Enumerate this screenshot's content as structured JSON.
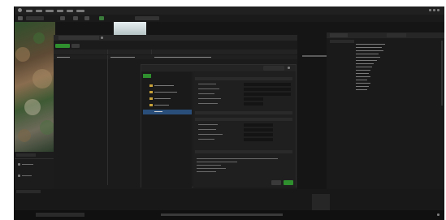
{
  "colors": {
    "window_bg": "#151515",
    "panel_bg": "#1c1c1c",
    "accent_green": "#2f8f2f",
    "accent_blue": "#2a4e7a",
    "terrain_brown": "#7a5a3a",
    "terrain_green": "#3f6a35"
  },
  "icons": {
    "app": "app-logo-icon",
    "close": "close-icon",
    "search": "search-icon",
    "folder": "folder-icon",
    "play": "play-icon",
    "gear": "gear-icon"
  },
  "dialog": {
    "title": "",
    "confirm_label": "",
    "cancel_label": ""
  }
}
